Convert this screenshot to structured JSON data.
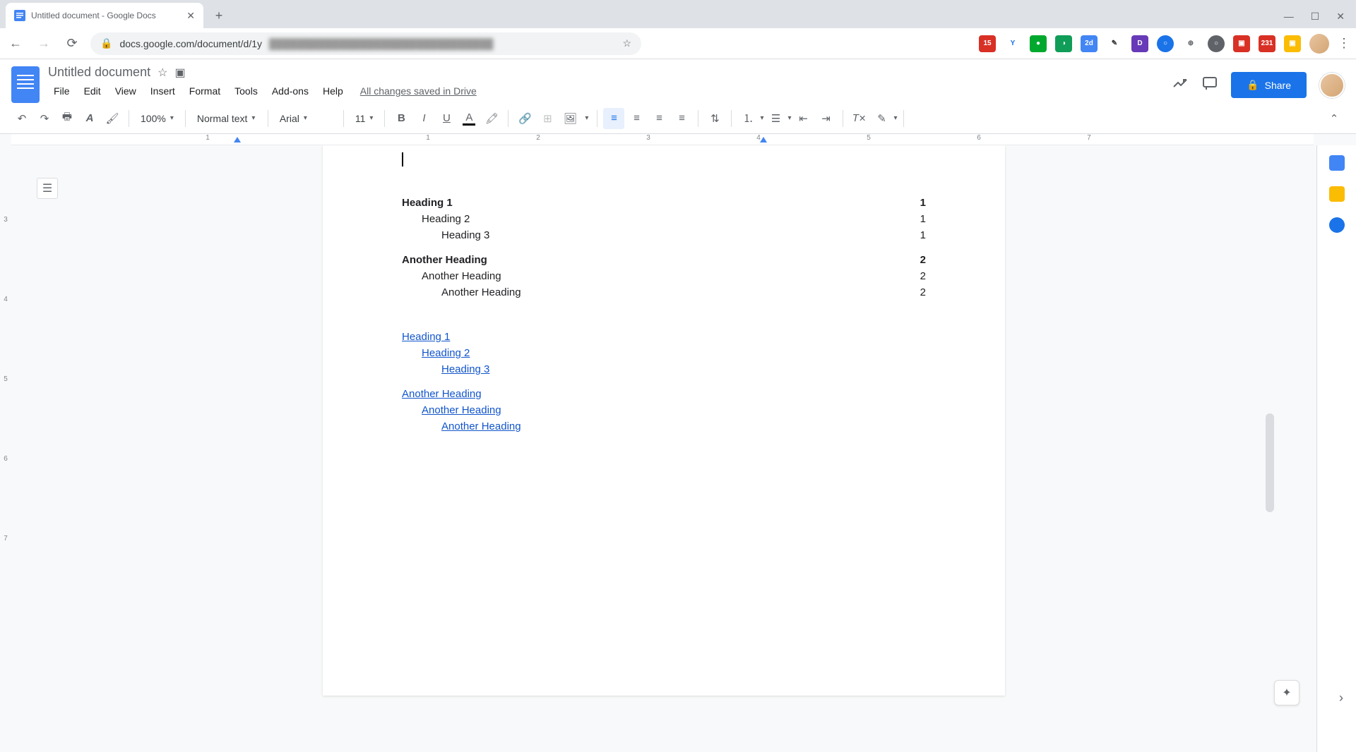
{
  "browser": {
    "tab_title": "Untitled document - Google Docs",
    "url": "docs.google.com/document/d/1y"
  },
  "header": {
    "title": "Untitled document",
    "saved": "All changes saved in Drive",
    "share": "Share"
  },
  "menu": [
    "File",
    "Edit",
    "View",
    "Insert",
    "Format",
    "Tools",
    "Add-ons",
    "Help"
  ],
  "toolbar": {
    "zoom": "100%",
    "style": "Normal text",
    "font": "Arial",
    "size": "11"
  },
  "ruler": [
    "1",
    "",
    "1",
    "2",
    "3",
    "4",
    "5",
    "6",
    "7"
  ],
  "v_ruler": [
    "3",
    "4",
    "5",
    "6",
    "7"
  ],
  "toc_numbered": [
    {
      "text": "Heading 1",
      "page": "1",
      "level": 0,
      "bold": true
    },
    {
      "text": "Heading 2",
      "page": "1",
      "level": 1,
      "bold": false
    },
    {
      "text": "Heading 3",
      "page": "1",
      "level": 2,
      "bold": false
    },
    {
      "text": "Another Heading",
      "page": "2",
      "level": 0,
      "bold": true
    },
    {
      "text": "Another Heading",
      "page": "2",
      "level": 1,
      "bold": false
    },
    {
      "text": "Another Heading",
      "page": "2",
      "level": 2,
      "bold": false
    }
  ],
  "toc_links": [
    {
      "text": "Heading 1",
      "level": 0
    },
    {
      "text": "Heading 2",
      "level": 1
    },
    {
      "text": "Heading 3",
      "level": 2
    },
    {
      "text": "Another Heading",
      "level": 0
    },
    {
      "text": "Another Heading",
      "level": 1
    },
    {
      "text": "Another Heading",
      "level": 2
    }
  ]
}
